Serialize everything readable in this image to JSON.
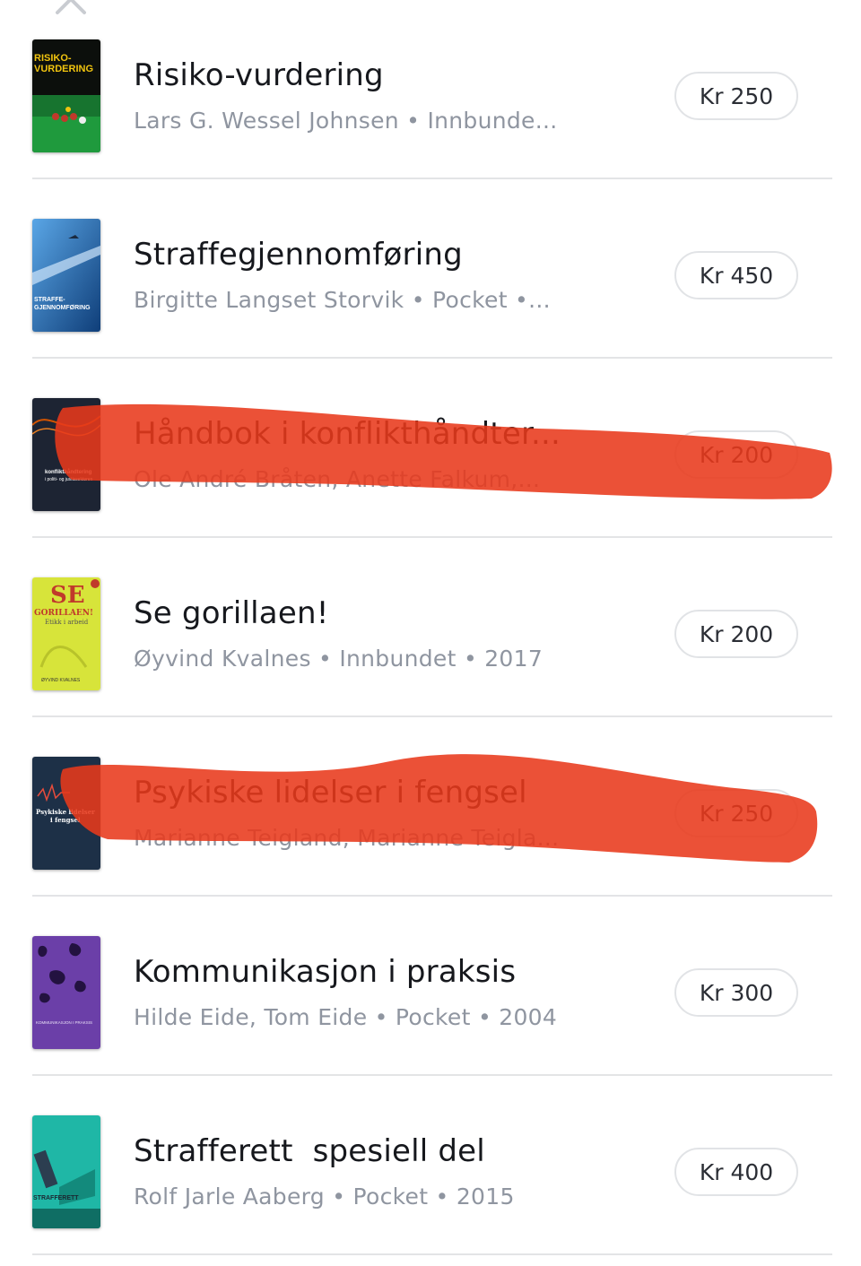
{
  "close_icon": "close-icon",
  "scribble_color": "#e8391b",
  "books": [
    {
      "title": "Risiko-vurdering",
      "meta": "Lars G. Wessel Johnsen • Innbunde...",
      "price": "Kr 250",
      "cover_text": "RISIKO-\nVURDERING"
    },
    {
      "title": "Straffegjennomføring",
      "meta": "Birgitte Langset Storvik • Pocket •...",
      "price": "Kr 450",
      "cover_text": "STRAFFE-\nGJENNOMFØRING"
    },
    {
      "title": "Håndbok i konflikthåndter...",
      "meta": "Ole André Bråten, Anette Falkum,...",
      "price": "Kr 200",
      "cover_text": "konflikthåndtering\ni politi- og justissektoren"
    },
    {
      "title": "Se gorillaen!",
      "meta": "Øyvind Kvalnes • Innbundet • 2017",
      "price": "Kr 200",
      "cover_text": "SE\nGORILLAEN!\nEtikk i arbeid"
    },
    {
      "title": "Psykiske lidelser i fengsel",
      "meta": "Marianne Teigland, Marianne Teigla...",
      "price": "Kr 250",
      "cover_text": "Psykiske lidelser\ni fengsel"
    },
    {
      "title": "Kommunikasjon i praksis",
      "meta": "Hilde Eide, Tom Eide • Pocket • 2004",
      "price": "Kr 300",
      "cover_text": "KOMMUNIKASJON I PRAKSIS"
    },
    {
      "title": "Strafferett  spesiell del",
      "meta": "Rolf Jarle Aaberg • Pocket • 2015",
      "price": "Kr 400",
      "cover_text": "STRAFFERETT SPESIELL DEL"
    }
  ]
}
